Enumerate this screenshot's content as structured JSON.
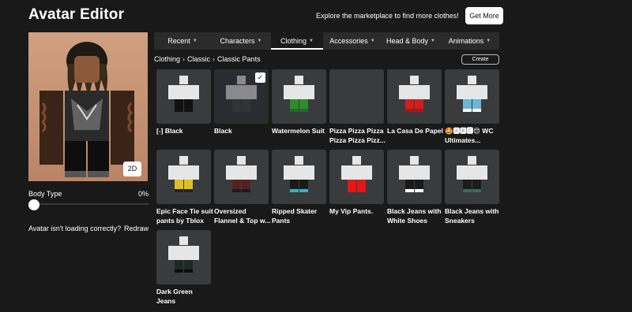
{
  "header": {
    "title": "Avatar Editor",
    "promo_text": "Explore the marketplace to find more clothes!",
    "get_more_label": "Get More"
  },
  "preview": {
    "toggle_2d_label": "2D",
    "body_type_label": "Body Type",
    "body_type_value": "0%",
    "body_type_fraction": 0,
    "loading_text": "Avatar isn't loading correctly?",
    "redraw_label": "Redraw"
  },
  "tabs": [
    {
      "label": "Recent",
      "active": false
    },
    {
      "label": "Characters",
      "active": false
    },
    {
      "label": "Clothing",
      "active": true
    },
    {
      "label": "Accessories",
      "active": false
    },
    {
      "label": "Head & Body",
      "active": false
    },
    {
      "label": "Animations",
      "active": false
    }
  ],
  "breadcrumb": [
    "Clothing",
    "Classic",
    "Classic Pants"
  ],
  "create_label": "Create",
  "items": [
    {
      "name": "[-] Black",
      "pants": "#111111",
      "shoes": "#111111",
      "selected": false
    },
    {
      "name": "Black",
      "pants": "#333333",
      "shoes": "#333333",
      "selected": true
    },
    {
      "name": "Watermelon Suit",
      "pants": "#2e8b2e",
      "shoes": "#1f6e1f",
      "selected": false
    },
    {
      "name": "Pizza Pizza Pizza Pizza Pizza Pizz...",
      "pants": "",
      "shoes": "",
      "selected": false
    },
    {
      "name": "La Casa De Papel",
      "pants": "#d21e1e",
      "shoes": "#b01515",
      "selected": false
    },
    {
      "name": "🤩🅰🅱🅲😍 WC Ultimates...",
      "pants": "#6ab6d6",
      "shoes": "#ffffff",
      "selected": false
    },
    {
      "name": "Epic Face Tie suit pants by Tblox",
      "pants": "#e0c020",
      "shoes": "#222222",
      "selected": false
    },
    {
      "name": "Oversized Flannel & Top w...",
      "pants": "#5a2020",
      "shoes": "#1a1a1a",
      "selected": false
    },
    {
      "name": "Ripped Skater Pants",
      "pants": "#1a1a1a",
      "shoes": "#2fb5c0",
      "selected": false
    },
    {
      "name": "My Vip Pants.",
      "pants": "#e01818",
      "shoes": "#e01818",
      "selected": false
    },
    {
      "name": "Black Jeans with White Shoes",
      "pants": "#1a1a1a",
      "shoes": "#ffffff",
      "selected": false
    },
    {
      "name": "Black Jeans with Sneakers",
      "pants": "#1c1c1c",
      "shoes": "#3a6a5a",
      "selected": false
    },
    {
      "name": "Dark Green Jeans",
      "pants": "#1d2a22",
      "shoes": "#0c0c0c",
      "selected": false
    }
  ],
  "colors": {
    "background": "#191919",
    "tile": "#393b3d",
    "tabbar": "#2b2b2b",
    "skin": "#b98466"
  }
}
